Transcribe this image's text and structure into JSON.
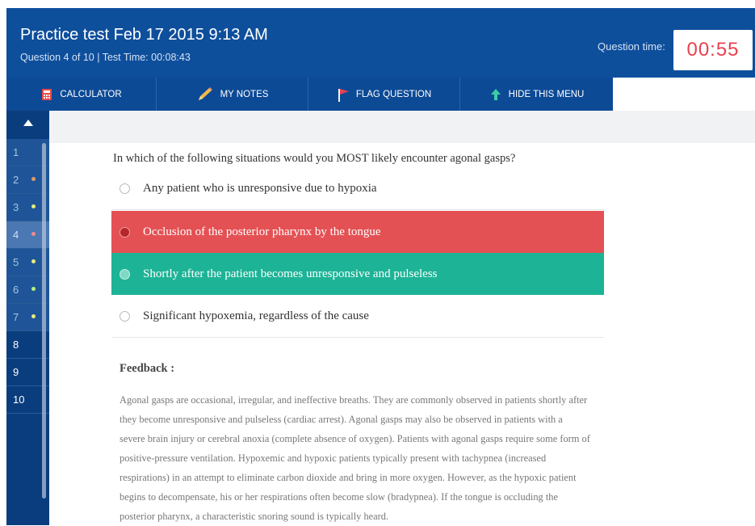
{
  "header": {
    "title": "Practice test Feb 17 2015 9:13 AM",
    "subtitle": "Question 4 of 10 | Test Time: 00:08:43",
    "question_time_label": "Question time:",
    "question_timer": "00:55"
  },
  "toolbar": {
    "calculator": "CALCULATOR",
    "notes": "MY NOTES",
    "flag": "FLAG QUESTION",
    "hide": "HIDE THIS MENU"
  },
  "sidebar": {
    "items": [
      {
        "number": "1",
        "state": "faded",
        "dot": ""
      },
      {
        "number": "2",
        "state": "faded",
        "dot": "#e29a6b"
      },
      {
        "number": "3",
        "state": "faded",
        "dot": "#e7ef7a"
      },
      {
        "number": "4",
        "state": "current",
        "dot": "#f08a8a"
      },
      {
        "number": "5",
        "state": "faded",
        "dot": "#e7ef7a"
      },
      {
        "number": "6",
        "state": "faded",
        "dot": "#b9ef7a"
      },
      {
        "number": "7",
        "state": "faded",
        "dot": "#e7ef7a"
      },
      {
        "number": "8",
        "state": "normal",
        "dot": ""
      },
      {
        "number": "9",
        "state": "normal",
        "dot": ""
      },
      {
        "number": "10",
        "state": "normal",
        "dot": ""
      }
    ]
  },
  "question": {
    "text": "In which of the following situations would you MOST likely encounter agonal gasps?",
    "options": [
      {
        "text": "Any patient who is unresponsive due to hypoxia",
        "state": "plain"
      },
      {
        "text": "Occlusion of the posterior pharynx by the tongue",
        "state": "wrong"
      },
      {
        "text": "Shortly after the patient becomes unresponsive and pulseless",
        "state": "right"
      },
      {
        "text": "Significant hypoxemia, regardless of the cause",
        "state": "plain"
      }
    ]
  },
  "feedback": {
    "title": "Feedback :",
    "lines": [
      "Agonal gasps are occasional, irregular, and ineffective breaths. They are commonly observed in patients shortly after",
      "they become unresponsive and pulseless (cardiac arrest). Agonal gasps may also be observed in patients with a",
      "severe brain injury or cerebral anoxia (complete absence of oxygen). Patients with agonal gasps require some form of",
      "positive-pressure ventilation. Hypoxemic and hypoxic patients typically present with tachypnea (increased",
      "respirations) in an attempt to eliminate carbon dioxide and bring in more oxygen. However, as the hypoxic patient",
      "begins to decompensate, his or her respirations often become slow (bradypnea). If the tongue is occluding the",
      "posterior pharynx, a characteristic snoring sound is typically heard."
    ]
  },
  "colors": {
    "header": "#0e4f9c",
    "wrong": "#e45154",
    "correct": "#1db396",
    "timer": "#e8414f"
  },
  "icons": {
    "calculator": "calculator-icon",
    "notes": "pencil-icon",
    "flag": "flag-icon",
    "hide": "arrow-up-icon",
    "sidebar_up": "caret-up-icon"
  }
}
